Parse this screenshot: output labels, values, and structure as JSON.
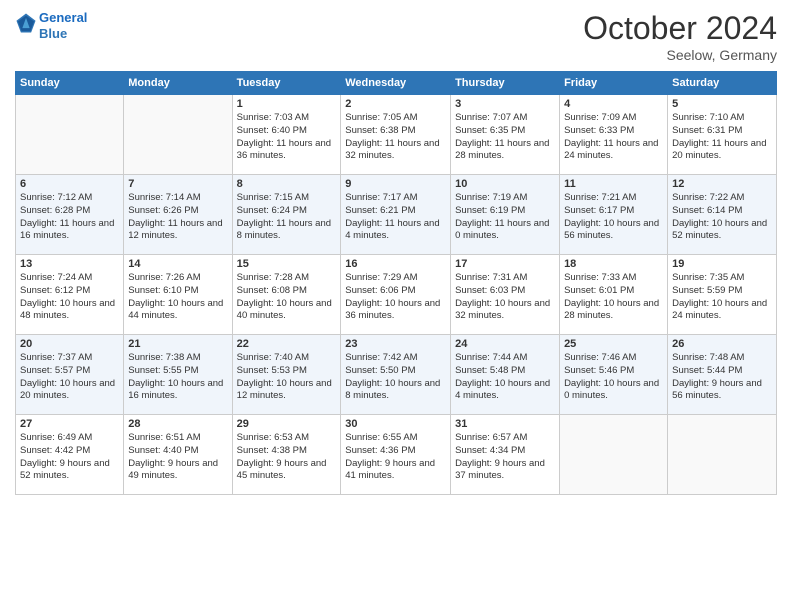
{
  "header": {
    "logo_line1": "General",
    "logo_line2": "Blue",
    "month_title": "October 2024",
    "location": "Seelow, Germany"
  },
  "weekdays": [
    "Sunday",
    "Monday",
    "Tuesday",
    "Wednesday",
    "Thursday",
    "Friday",
    "Saturday"
  ],
  "weeks": [
    [
      {
        "day": "",
        "info": ""
      },
      {
        "day": "",
        "info": ""
      },
      {
        "day": "1",
        "info": "Sunrise: 7:03 AM\nSunset: 6:40 PM\nDaylight: 11 hours and 36 minutes."
      },
      {
        "day": "2",
        "info": "Sunrise: 7:05 AM\nSunset: 6:38 PM\nDaylight: 11 hours and 32 minutes."
      },
      {
        "day": "3",
        "info": "Sunrise: 7:07 AM\nSunset: 6:35 PM\nDaylight: 11 hours and 28 minutes."
      },
      {
        "day": "4",
        "info": "Sunrise: 7:09 AM\nSunset: 6:33 PM\nDaylight: 11 hours and 24 minutes."
      },
      {
        "day": "5",
        "info": "Sunrise: 7:10 AM\nSunset: 6:31 PM\nDaylight: 11 hours and 20 minutes."
      }
    ],
    [
      {
        "day": "6",
        "info": "Sunrise: 7:12 AM\nSunset: 6:28 PM\nDaylight: 11 hours and 16 minutes."
      },
      {
        "day": "7",
        "info": "Sunrise: 7:14 AM\nSunset: 6:26 PM\nDaylight: 11 hours and 12 minutes."
      },
      {
        "day": "8",
        "info": "Sunrise: 7:15 AM\nSunset: 6:24 PM\nDaylight: 11 hours and 8 minutes."
      },
      {
        "day": "9",
        "info": "Sunrise: 7:17 AM\nSunset: 6:21 PM\nDaylight: 11 hours and 4 minutes."
      },
      {
        "day": "10",
        "info": "Sunrise: 7:19 AM\nSunset: 6:19 PM\nDaylight: 11 hours and 0 minutes."
      },
      {
        "day": "11",
        "info": "Sunrise: 7:21 AM\nSunset: 6:17 PM\nDaylight: 10 hours and 56 minutes."
      },
      {
        "day": "12",
        "info": "Sunrise: 7:22 AM\nSunset: 6:14 PM\nDaylight: 10 hours and 52 minutes."
      }
    ],
    [
      {
        "day": "13",
        "info": "Sunrise: 7:24 AM\nSunset: 6:12 PM\nDaylight: 10 hours and 48 minutes."
      },
      {
        "day": "14",
        "info": "Sunrise: 7:26 AM\nSunset: 6:10 PM\nDaylight: 10 hours and 44 minutes."
      },
      {
        "day": "15",
        "info": "Sunrise: 7:28 AM\nSunset: 6:08 PM\nDaylight: 10 hours and 40 minutes."
      },
      {
        "day": "16",
        "info": "Sunrise: 7:29 AM\nSunset: 6:06 PM\nDaylight: 10 hours and 36 minutes."
      },
      {
        "day": "17",
        "info": "Sunrise: 7:31 AM\nSunset: 6:03 PM\nDaylight: 10 hours and 32 minutes."
      },
      {
        "day": "18",
        "info": "Sunrise: 7:33 AM\nSunset: 6:01 PM\nDaylight: 10 hours and 28 minutes."
      },
      {
        "day": "19",
        "info": "Sunrise: 7:35 AM\nSunset: 5:59 PM\nDaylight: 10 hours and 24 minutes."
      }
    ],
    [
      {
        "day": "20",
        "info": "Sunrise: 7:37 AM\nSunset: 5:57 PM\nDaylight: 10 hours and 20 minutes."
      },
      {
        "day": "21",
        "info": "Sunrise: 7:38 AM\nSunset: 5:55 PM\nDaylight: 10 hours and 16 minutes."
      },
      {
        "day": "22",
        "info": "Sunrise: 7:40 AM\nSunset: 5:53 PM\nDaylight: 10 hours and 12 minutes."
      },
      {
        "day": "23",
        "info": "Sunrise: 7:42 AM\nSunset: 5:50 PM\nDaylight: 10 hours and 8 minutes."
      },
      {
        "day": "24",
        "info": "Sunrise: 7:44 AM\nSunset: 5:48 PM\nDaylight: 10 hours and 4 minutes."
      },
      {
        "day": "25",
        "info": "Sunrise: 7:46 AM\nSunset: 5:46 PM\nDaylight: 10 hours and 0 minutes."
      },
      {
        "day": "26",
        "info": "Sunrise: 7:48 AM\nSunset: 5:44 PM\nDaylight: 9 hours and 56 minutes."
      }
    ],
    [
      {
        "day": "27",
        "info": "Sunrise: 6:49 AM\nSunset: 4:42 PM\nDaylight: 9 hours and 52 minutes."
      },
      {
        "day": "28",
        "info": "Sunrise: 6:51 AM\nSunset: 4:40 PM\nDaylight: 9 hours and 49 minutes."
      },
      {
        "day": "29",
        "info": "Sunrise: 6:53 AM\nSunset: 4:38 PM\nDaylight: 9 hours and 45 minutes."
      },
      {
        "day": "30",
        "info": "Sunrise: 6:55 AM\nSunset: 4:36 PM\nDaylight: 9 hours and 41 minutes."
      },
      {
        "day": "31",
        "info": "Sunrise: 6:57 AM\nSunset: 4:34 PM\nDaylight: 9 hours and 37 minutes."
      },
      {
        "day": "",
        "info": ""
      },
      {
        "day": "",
        "info": ""
      }
    ]
  ]
}
